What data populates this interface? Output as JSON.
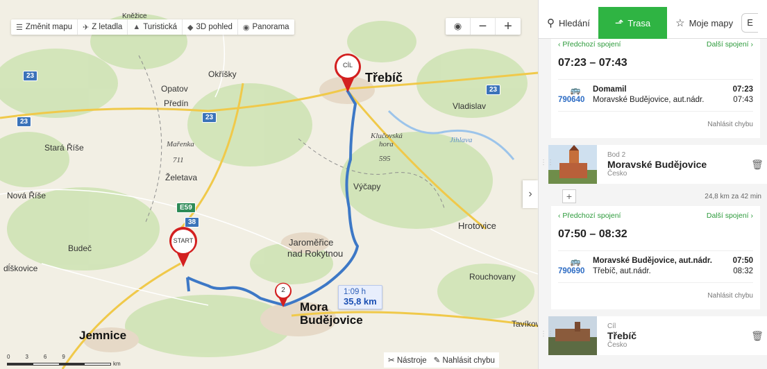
{
  "toolbar": {
    "change_map": "Změnit mapu",
    "aerial": "Z letadla",
    "tourist": "Turistická",
    "view3d": "3D pohled",
    "panorama": "Panorama"
  },
  "map_labels": {
    "trebic": "Třebíč",
    "okrisky": "Okříšky",
    "opatov": "Opatov",
    "predin": "Předín",
    "vladislav": "Vladislav",
    "stara_rise": "Stará Říše",
    "marenka": "Mařenka",
    "marenka_height": "711",
    "klucovska": "Klučovská",
    "hora": "hora",
    "klucovska_height": "595",
    "jihlava": "Jihlava",
    "zeletava": "Želetava",
    "vycapy": "Výčapy",
    "nova_rise": "Nová Říše",
    "hrotovice": "Hrotovice",
    "budec": "Budeč",
    "jaromerice_1": "Jaroměřice",
    "jaromerice_2": "nad Rokytnou",
    "diskovice": "dĺškovice",
    "rouchovany": "Rouchovany",
    "mb_1": "Mora",
    "mb_2": "Budějovice",
    "tavikovice": "Tavíkov",
    "jemnice": "Jemnice",
    "knezice": "Kněžice"
  },
  "road_shields": {
    "r23a": "23",
    "r23b": "23",
    "r23c": "23",
    "r23d": "23",
    "e59": "E59",
    "r38": "38"
  },
  "pins": {
    "start": "START",
    "end": "CÍL",
    "mid": "2"
  },
  "route": {
    "time": "1:09 h",
    "distance": "35,8 km"
  },
  "bottom_tools": {
    "tools": "Nástroje",
    "report": "Nahlásit chybu"
  },
  "scale": {
    "t0": "0",
    "t3": "3",
    "t6": "6",
    "t9": "9",
    "unit": "km"
  },
  "tabs": {
    "search": "Hledání",
    "route": "Trasa",
    "mymaps": "Moje mapy",
    "more": "E"
  },
  "connections": [
    {
      "prev": "Předchozí spojení",
      "next": "Další spojení",
      "time_range": "07:23 – 07:43",
      "bus_number": "790640",
      "from": "Domamil",
      "to": "Moravské Budějovice, aut.nádr.",
      "dep": "07:23",
      "arr": "07:43",
      "report": "Nahlásit chybu"
    },
    {
      "prev": "Předchozí spojení",
      "next": "Další spojení",
      "time_range": "07:50 – 08:32",
      "bus_number": "790690",
      "from": "Moravské Budějovice, aut.nádr.",
      "to": "Třebíč, aut.nádr.",
      "dep": "07:50",
      "arr": "08:32",
      "report": "Nahlásit chybu"
    }
  ],
  "waypoints": [
    {
      "label": "Bod 2",
      "name": "Moravské Budějovice",
      "country": "Česko"
    },
    {
      "label": "Cíl",
      "name": "Třebíč",
      "country": "Česko"
    }
  ],
  "segment_distance": "24,8 km za 42 min",
  "colors": {
    "route": "#3d78c6",
    "accent": "#2fb443",
    "pin": "#d32020"
  }
}
